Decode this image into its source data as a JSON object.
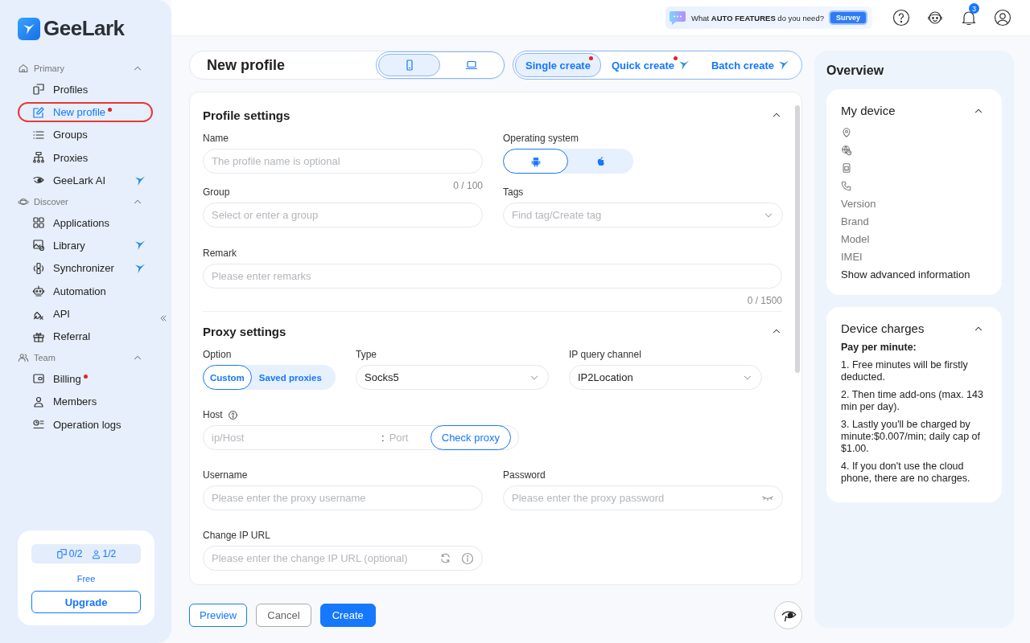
{
  "logo": "GeeLark",
  "sidebar": {
    "sections": [
      {
        "label": "Primary",
        "expanded": true,
        "items": [
          {
            "label": "Profiles",
            "selected": false,
            "dot": false,
            "bird": false
          },
          {
            "label": "New profile",
            "selected": true,
            "dot": true,
            "bird": false
          },
          {
            "label": "Groups",
            "selected": false,
            "dot": false,
            "bird": false
          },
          {
            "label": "Proxies",
            "selected": false,
            "dot": false,
            "bird": false
          },
          {
            "label": "GeeLark AI",
            "selected": false,
            "dot": false,
            "bird": true
          }
        ]
      },
      {
        "label": "Discover",
        "expanded": true,
        "items": [
          {
            "label": "Applications",
            "selected": false,
            "dot": false,
            "bird": false
          },
          {
            "label": "Library",
            "selected": false,
            "dot": false,
            "bird": true
          },
          {
            "label": "Synchronizer",
            "selected": false,
            "dot": false,
            "bird": true
          },
          {
            "label": "Automation",
            "selected": false,
            "dot": false,
            "bird": false
          },
          {
            "label": "API",
            "selected": false,
            "dot": false,
            "bird": false
          },
          {
            "label": "Referral",
            "selected": false,
            "dot": false,
            "bird": false
          }
        ]
      },
      {
        "label": "Team",
        "expanded": true,
        "items": [
          {
            "label": "Billing",
            "selected": false,
            "dot": true,
            "bird": false
          },
          {
            "label": "Members",
            "selected": false,
            "dot": false,
            "bird": false
          },
          {
            "label": "Operation logs",
            "selected": false,
            "dot": false,
            "bird": false
          }
        ]
      }
    ],
    "plan": {
      "devices": "0/2",
      "members": "1/2",
      "name": "Free",
      "upgrade": "Upgrade"
    }
  },
  "topbar": {
    "survey_text": "What **AUTO FEATURES** do you need?",
    "survey_button": "Survey",
    "notification_count": "3"
  },
  "header": {
    "title": "New profile",
    "device_tabs": [
      {
        "kind": "phone",
        "selected": true
      },
      {
        "kind": "laptop",
        "selected": false
      }
    ],
    "create_tabs": [
      {
        "label": "Single create",
        "selected": true,
        "dot": true,
        "bird": false
      },
      {
        "label": "Quick create",
        "selected": false,
        "dot": true,
        "bird": true
      },
      {
        "label": "Batch create",
        "selected": false,
        "dot": false,
        "bird": true
      }
    ]
  },
  "profile_settings": {
    "title": "Profile settings",
    "expanded": true,
    "name": {
      "label": "Name",
      "placeholder": "The profile name is optional",
      "counter": "0 / 100"
    },
    "os": {
      "label": "Operating system",
      "options": [
        {
          "kind": "android",
          "selected": true
        },
        {
          "kind": "apple",
          "selected": false
        }
      ]
    },
    "group": {
      "label": "Group",
      "placeholder": "Select or enter a group"
    },
    "tags": {
      "label": "Tags",
      "placeholder": "Find tag/Create tag"
    },
    "remark": {
      "label": "Remark",
      "placeholder": "Please enter remarks",
      "counter": "0 / 1500"
    }
  },
  "proxy_settings": {
    "title": "Proxy settings",
    "expanded": true,
    "option": {
      "label": "Option",
      "choices": [
        {
          "label": "Custom",
          "selected": true
        },
        {
          "label": "Saved proxies",
          "selected": false
        }
      ]
    },
    "type": {
      "label": "Type",
      "value": "Socks5"
    },
    "ip_channel": {
      "label": "IP query channel",
      "value": "IP2Location"
    },
    "host": {
      "label": "Host",
      "host_placeholder": "ip/Host",
      "separator": ":",
      "port_placeholder": "Port",
      "check_button": "Check proxy"
    },
    "username": {
      "label": "Username",
      "placeholder": "Please enter the proxy username"
    },
    "password": {
      "label": "Password",
      "placeholder": "Please enter the proxy password"
    },
    "change_ip_url": {
      "label": "Change IP URL",
      "placeholder": "Please enter the change IP URL (optional)"
    }
  },
  "actions": [
    {
      "label": "Preview",
      "kind": "outline"
    },
    {
      "label": "Cancel",
      "kind": "plain"
    },
    {
      "label": "Create",
      "kind": "primary"
    }
  ],
  "overview": {
    "title": "Overview",
    "my_device": {
      "title": "My device",
      "expanded": true,
      "fields": [
        "Version",
        "Brand",
        "Model",
        "IMEI"
      ],
      "link": "Show advanced information"
    },
    "device_charges": {
      "title": "Device charges",
      "expanded": true,
      "heading": "Pay per minute:",
      "lines": [
        "1. Free minutes will be firstly deducted.",
        "2. Then time add-ons (max. 143 min per day).",
        "3. Lastly you'll be charged by minute:$0.007/min; daily cap of $1.00.",
        "4. If you don't use the cloud phone, there are no charges."
      ]
    }
  }
}
